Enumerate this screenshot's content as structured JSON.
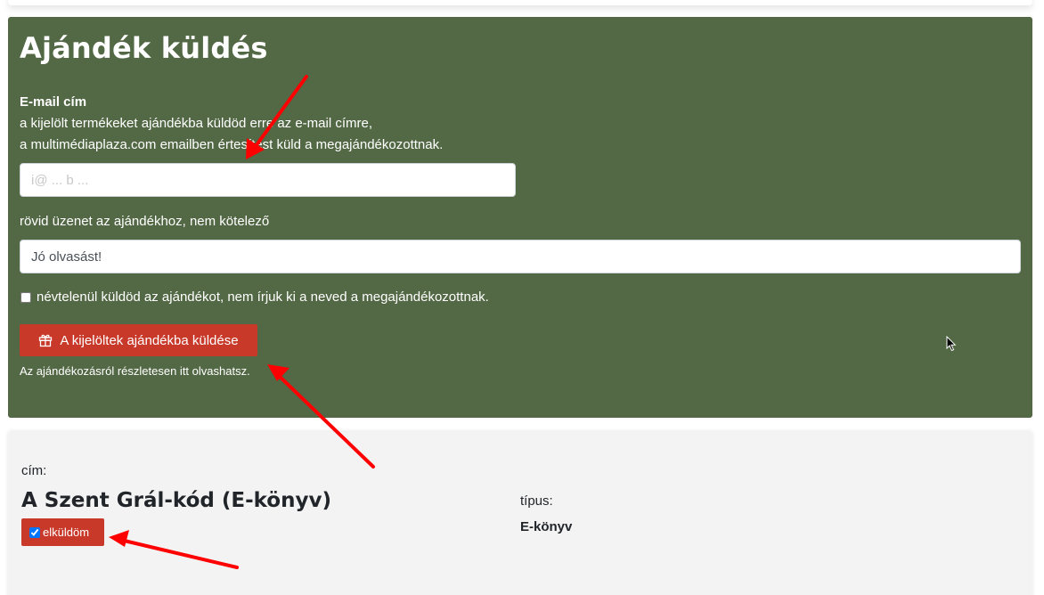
{
  "gift_panel": {
    "title": "Ajándék küldés",
    "email_label": "E-mail cím",
    "email_help_line1": "a kijelölt termékeket ajándékba küldöd erre az e-mail címre,",
    "email_help_line2": "a multimédiaplaza.com emailben értesítést küld a megajándékozottnak.",
    "email_value": "i@ ... b ...",
    "message_label": "rövid üzenet az ajándékhoz, nem kötelező",
    "message_value": "Jó olvasást!",
    "anonymous_label": "névtelenül küldöd az ajándékot, nem írjuk ki a neved a megajándékozottnak.",
    "anonymous_checked": false,
    "send_button_label": "A kijelöltek ajándékba küldése",
    "info_link": "Az ajándékozásról részletesen itt olvashatsz."
  },
  "product": {
    "title_label": "cím:",
    "title": "A Szent Grál-kód (E-könyv)",
    "send_toggle_label": "elküldöm",
    "send_toggle_checked": true,
    "type_label": "típus:",
    "type_value": "E-könyv"
  },
  "colors": {
    "panel_bg": "#536945",
    "button_red": "#c8392a",
    "card_bg": "#f3f3f3",
    "annotation_arrow": "#ff0000"
  },
  "icons": {
    "send_button_icon": "gift-icon",
    "cursor": "mouse-pointer-icon"
  }
}
